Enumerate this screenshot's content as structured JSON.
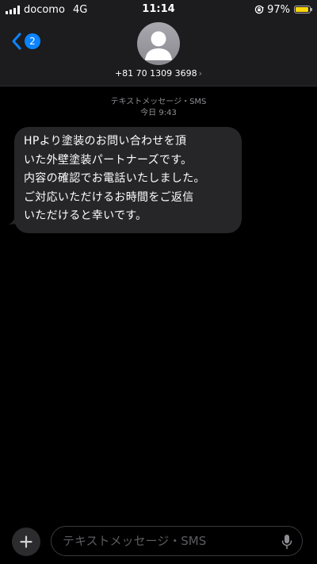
{
  "status_bar": {
    "carrier": "docomo",
    "network": "4G",
    "time": "11:14",
    "battery_percent": "97%",
    "battery_level": 0.97,
    "battery_color": "#ffd60a"
  },
  "header": {
    "back_badge_count": "2",
    "contact_name": "+81 70 1309 3698",
    "contact_chevron": "›",
    "avatar_icon": "person-silhouette-icon"
  },
  "thread": {
    "service_label": "テキストメッセージ・SMS",
    "timestamp": "今日 9:43"
  },
  "messages": [
    {
      "direction": "incoming",
      "lines": [
        "HPより塗装のお問い合わせを頂",
        "いた外壁塗装パートナーズです。",
        "内容の確認でお電話いたしました。",
        "ご対応いただけるお時間をご返信",
        "いただけると幸いです。"
      ]
    }
  ],
  "composer": {
    "placeholder": "テキストメッセージ・SMS",
    "value": ""
  },
  "colors": {
    "accent": "#0a84ff",
    "bubble_incoming": "#262628",
    "background": "#000000",
    "header_background": "#1c1c1e",
    "secondary_text": "#8e8e93"
  }
}
